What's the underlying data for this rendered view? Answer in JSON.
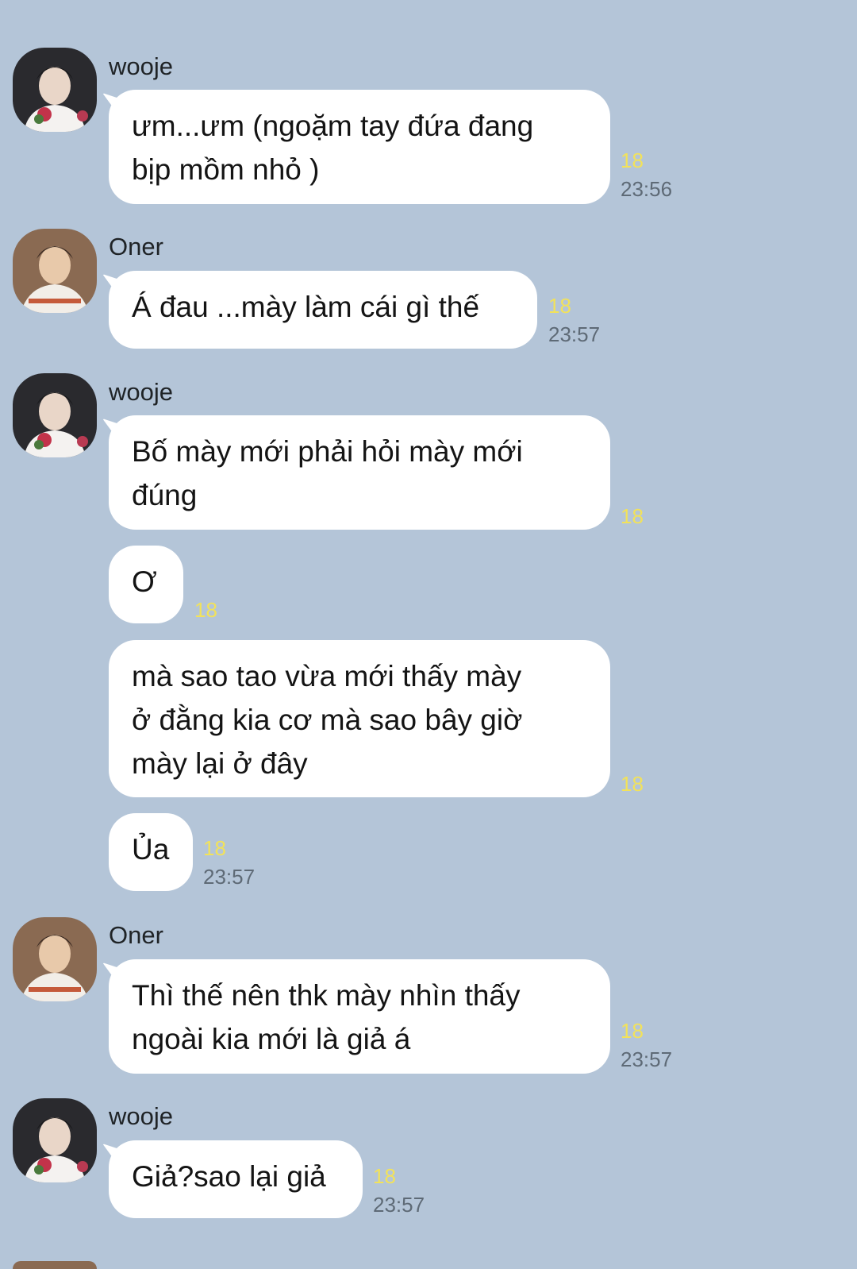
{
  "colors": {
    "background": "#b4c5d8",
    "bubble": "#ffffff",
    "unread": "#f2e25a",
    "time": "#5e6a76"
  },
  "senders": {
    "a": {
      "name": "wooje",
      "avatar": "avatar-wooje"
    },
    "b": {
      "name": "Oner",
      "avatar": "avatar-oner"
    }
  },
  "messages": [
    {
      "sender": "wooje",
      "text": "ưm...ưm (ngoặm tay đứa đang\nbịp mồm nhỏ )",
      "unread": "18",
      "time": "23:56"
    },
    {
      "sender": "Oner",
      "text": "Á đau ...mày làm cái gì thế",
      "unread": "18",
      "time": "23:57"
    },
    {
      "sender": "wooje",
      "text": "Bố mày mới phải hỏi mày mới\nđúng",
      "unread": "18",
      "time": ""
    },
    {
      "sender": "",
      "text": "Ơ",
      "unread": "18",
      "time": ""
    },
    {
      "sender": "",
      "text": "mà sao tao vừa mới thấy mày\nở đằng kia cơ mà sao bây giờ\nmày lại ở đây",
      "unread": "18",
      "time": ""
    },
    {
      "sender": "",
      "text": "Ủa",
      "unread": "18",
      "time": "23:57"
    },
    {
      "sender": "Oner",
      "text": "Thì thế nên thk mày nhìn thấy\nngoài kia mới là giả á",
      "unread": "18",
      "time": "23:57"
    },
    {
      "sender": "wooje",
      "text": "Giả?sao lại giả",
      "unread": "18",
      "time": "23:57"
    }
  ]
}
